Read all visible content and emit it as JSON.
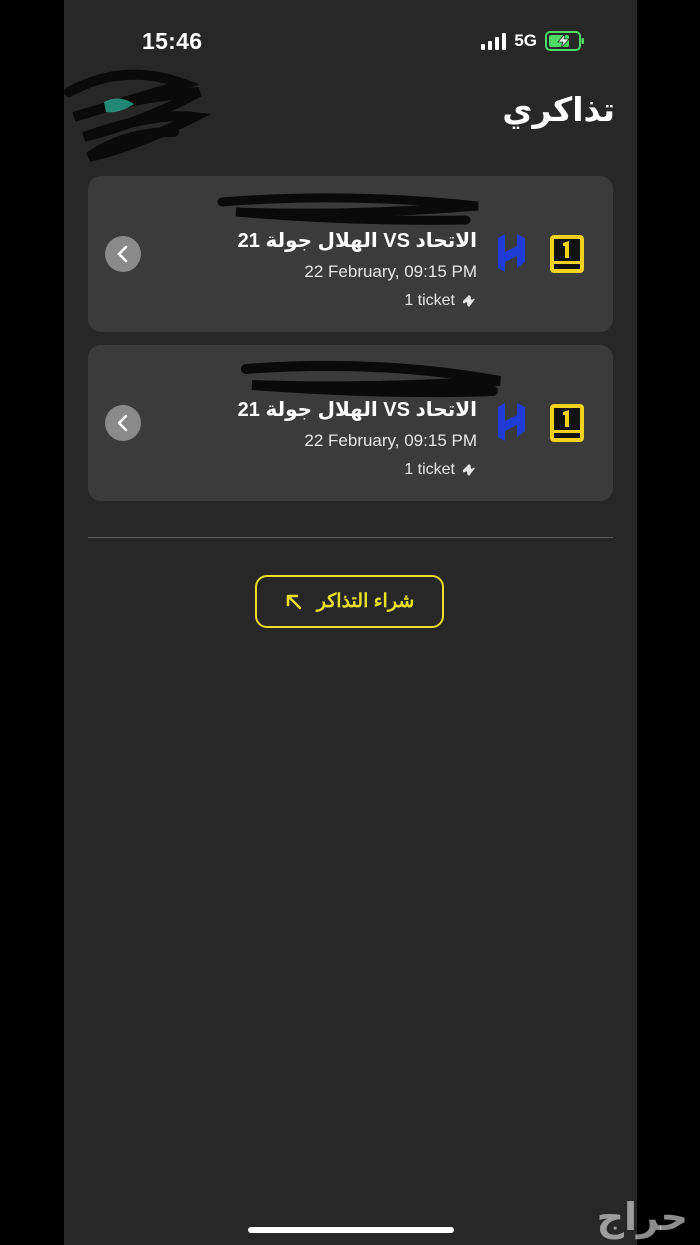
{
  "status_bar": {
    "time": "15:46",
    "network": "5G"
  },
  "header": {
    "title": "تذاكري"
  },
  "tickets": [
    {
      "match": "الاتحاد VS الهلال جولة 21",
      "datetime": "22 February, 09:15 PM",
      "count": "1 ticket",
      "home_team_logo": "ittihad-logo",
      "away_team_logo": "hilal-logo"
    },
    {
      "match": "الاتحاد VS الهلال جولة 21",
      "datetime": "22 February, 09:15 PM",
      "count": "1 ticket",
      "home_team_logo": "ittihad-logo",
      "away_team_logo": "hilal-logo"
    }
  ],
  "buy_button": {
    "label": "شراء التذاكر",
    "icon": "arrow-up-left-icon"
  },
  "watermark": "حراج",
  "colors": {
    "background": "#272727",
    "card": "#3b3b3b",
    "accent": "#e7e026",
    "hilal_blue": "#1f3bd6",
    "ittihad_yellow": "#f2d21b"
  }
}
